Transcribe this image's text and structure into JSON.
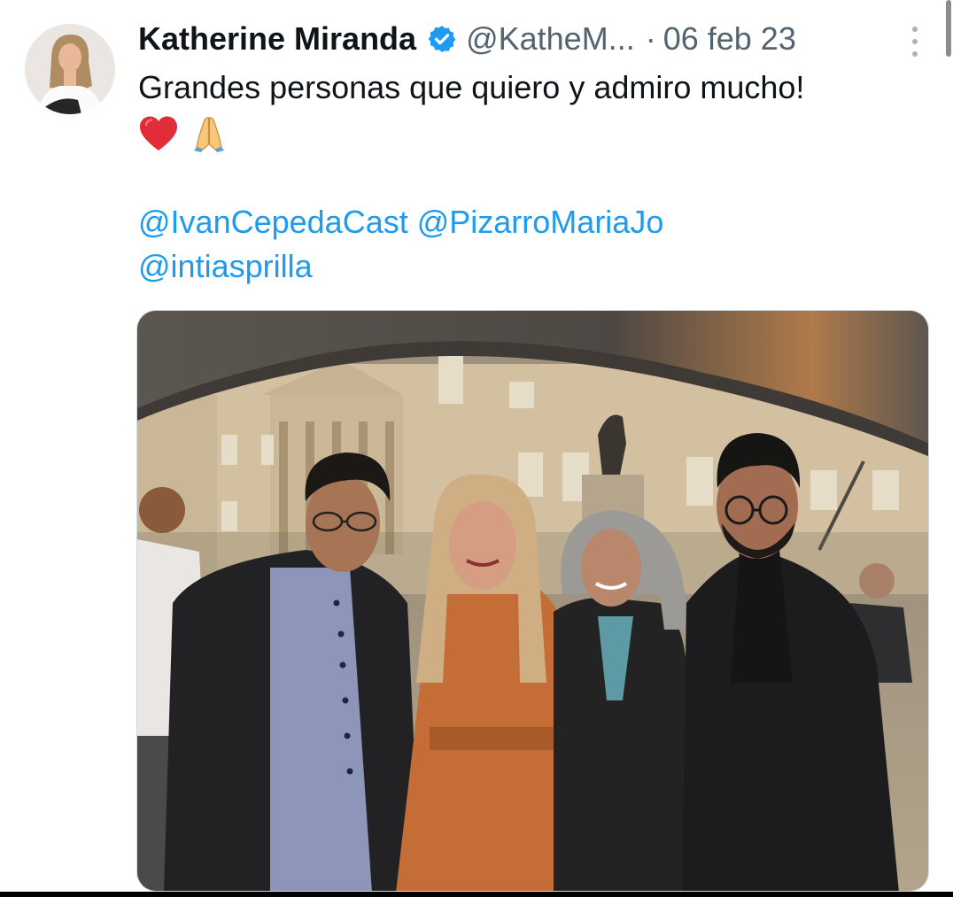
{
  "tweet": {
    "author_name": "Katherine Miranda",
    "handle": "@KatheM...",
    "separator": "·",
    "date": "06 feb 23",
    "text": "Grandes personas que quiero y admiro mucho!",
    "emojis": [
      "heart-icon",
      "folded-hands-icon"
    ],
    "mentions_line1": [
      "@IvanCepedaCast",
      "@PizarroMariaJo"
    ],
    "mentions_line2": [
      "@intiasprilla"
    ]
  },
  "colors": {
    "link": "#1d9bf0",
    "verified": "#1d9bf0",
    "secondary_text": "#536471",
    "primary_text": "#0f1419"
  }
}
